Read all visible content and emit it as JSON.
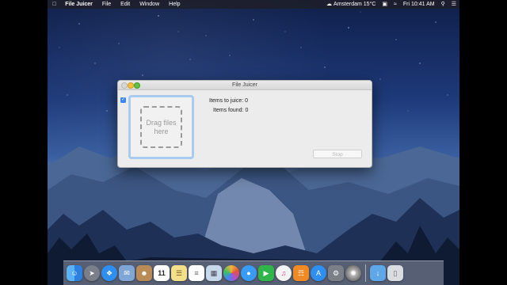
{
  "menubar": {
    "apple_icon": "apple-icon",
    "app_name": "File Juicer",
    "menus": [
      "File",
      "Edit",
      "Window",
      "Help"
    ],
    "weather": "Amsterdam 15°C",
    "datetime": "Fri 10:41 AM"
  },
  "window": {
    "title": "File Juicer",
    "drop_text": "Drag files here",
    "items_to_juice": "Items to juice: 0",
    "items_found": "Items found: 0",
    "stop_label": "Stop",
    "checkbox_checked": true
  },
  "dock": {
    "apps": [
      "finder-icon",
      "launchpad-icon",
      "safari-icon",
      "mail-icon",
      "contacts-icon",
      "calendar-icon",
      "notes-icon",
      "reminders-icon",
      "preview-icon",
      "photos-icon",
      "messages-icon",
      "facetime-icon",
      "itunes-icon",
      "ibooks-icon",
      "app-store-icon",
      "system-preferences-icon",
      "file-juicer-icon"
    ],
    "calendar_day": "11",
    "right": [
      "downloads-folder-icon",
      "trash-icon"
    ]
  }
}
